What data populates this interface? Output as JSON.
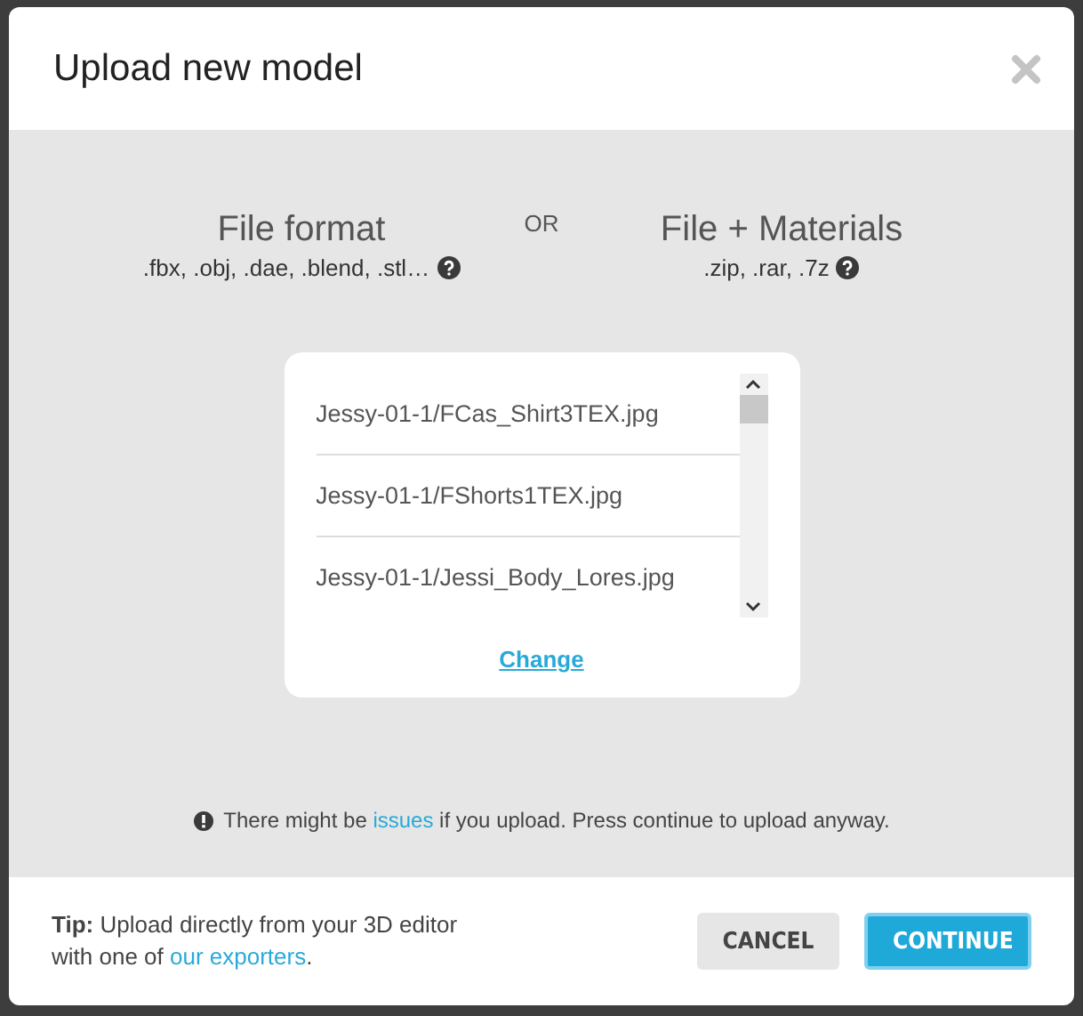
{
  "dialog": {
    "title": "Upload new model"
  },
  "options": [
    {
      "title": "File format",
      "formats": ".fbx, .obj, .dae, .blend, .stl…"
    },
    {
      "title": "File + Materials",
      "formats": ".zip, .rar, .7z"
    }
  ],
  "separator": "OR",
  "files": [
    "Jessy-01-1/FCas_Shirt3TEX.jpg",
    "Jessy-01-1/FShorts1TEX.jpg",
    "Jessy-01-1/Jessi_Body_Lores.jpg"
  ],
  "change_link": "Change",
  "warning": {
    "before": "There might be ",
    "link": "issues",
    "after": " if you upload. Press continue to upload anyway."
  },
  "tip": {
    "before": "**Tip:** Upload directly from your 3D editor with one of ",
    "link": "our exporters",
    "after": "."
  },
  "buttons": [
    {
      "label": "CANCEL",
      "kind": "secondary"
    },
    {
      "label": "CONTINUE",
      "kind": "primary"
    }
  ]
}
